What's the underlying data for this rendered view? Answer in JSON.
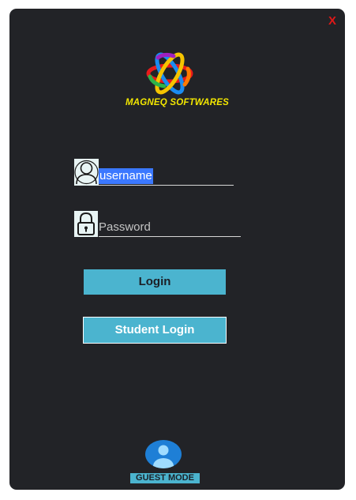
{
  "window": {
    "close_label": "X",
    "brand_name": "MAGNEQ SOFTWARES"
  },
  "login_form": {
    "username_value": "username",
    "password_placeholder": "Password",
    "login_button_label": "Login",
    "student_login_button_label": "Student Login"
  },
  "guest": {
    "label": "GUEST MODE"
  },
  "icons": {
    "logo": "magneq-logo-icon",
    "user": "user-icon",
    "lock": "lock-icon",
    "guest": "guest-avatar-icon"
  },
  "colors": {
    "window_background": "#222327",
    "accent": "#4bb4cf",
    "brand_text": "#f2e600",
    "close": "#e01818",
    "selection": "#3b78ff"
  }
}
